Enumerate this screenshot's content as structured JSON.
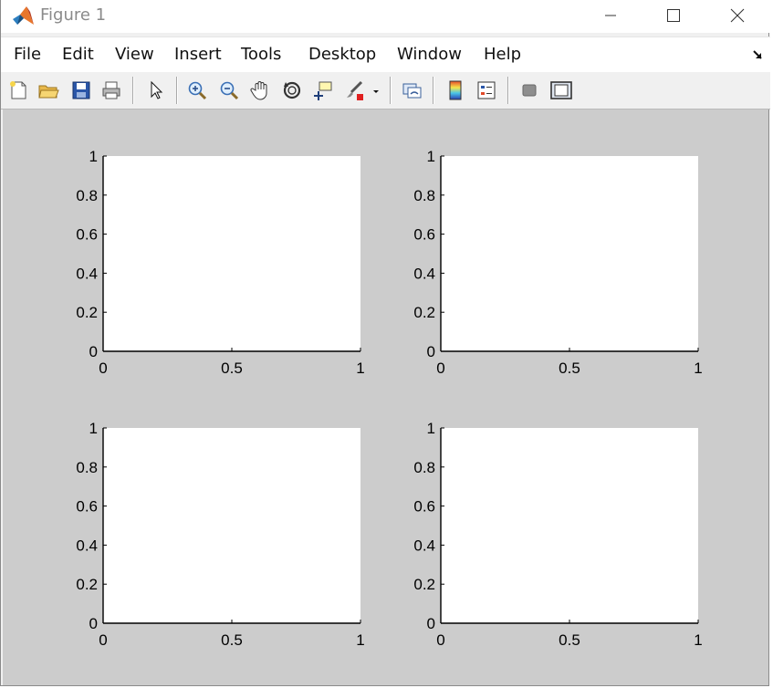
{
  "window": {
    "title": "Figure 1",
    "accent": "#cccccc"
  },
  "menu": {
    "items": [
      "File",
      "Edit",
      "View",
      "Insert",
      "Tools",
      "Desktop",
      "Window",
      "Help"
    ]
  },
  "toolbar": {
    "icons": [
      "new-figure-icon",
      "open-file-icon",
      "save-icon",
      "print-icon",
      "edit-plot-icon",
      "zoom-in-icon",
      "zoom-out-icon",
      "pan-icon",
      "rotate-3d-icon",
      "data-cursor-icon",
      "brush-icon",
      "brush-dropdown-icon",
      "link-plot-icon",
      "insert-colorbar-icon",
      "insert-legend-icon",
      "hide-plot-tools-icon",
      "show-plot-tools-icon"
    ]
  },
  "chart_data": [
    {
      "type": "line",
      "x_ticks": [
        "0",
        "0.5",
        "1"
      ],
      "y_ticks": [
        "0",
        "0.2",
        "0.4",
        "0.6",
        "0.8",
        "1"
      ],
      "xlim": [
        0,
        1
      ],
      "ylim": [
        0,
        1
      ],
      "series": []
    },
    {
      "type": "line",
      "x_ticks": [
        "0",
        "0.5",
        "1"
      ],
      "y_ticks": [
        "0",
        "0.2",
        "0.4",
        "0.6",
        "0.8",
        "1"
      ],
      "xlim": [
        0,
        1
      ],
      "ylim": [
        0,
        1
      ],
      "series": []
    },
    {
      "type": "line",
      "x_ticks": [
        "0",
        "0.5",
        "1"
      ],
      "y_ticks": [
        "0",
        "0.2",
        "0.4",
        "0.6",
        "0.8",
        "1"
      ],
      "xlim": [
        0,
        1
      ],
      "ylim": [
        0,
        1
      ],
      "series": []
    },
    {
      "type": "line",
      "x_ticks": [
        "0",
        "0.5",
        "1"
      ],
      "y_ticks": [
        "0",
        "0.2",
        "0.4",
        "0.6",
        "0.8",
        "1"
      ],
      "xlim": [
        0,
        1
      ],
      "ylim": [
        0,
        1
      ],
      "series": []
    }
  ]
}
